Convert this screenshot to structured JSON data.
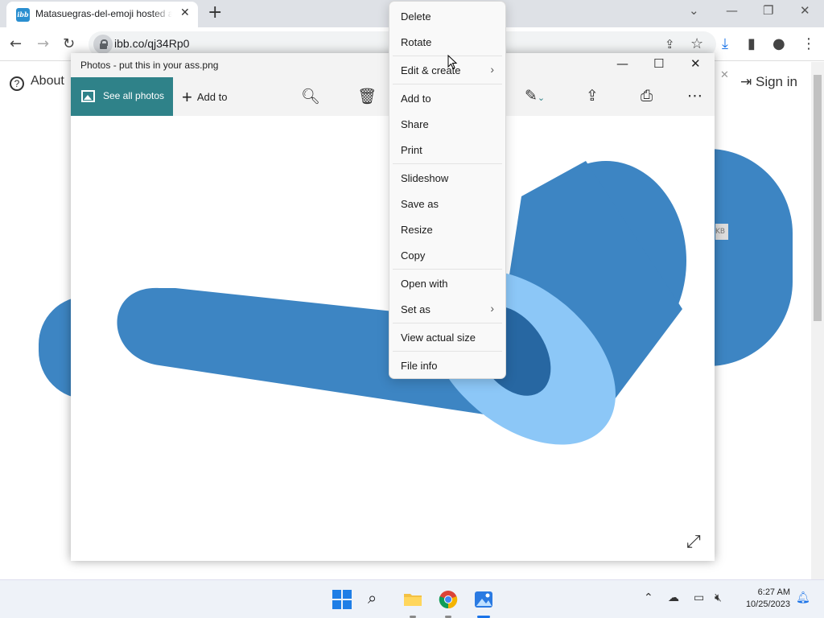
{
  "browser": {
    "tab_title": "Matasuegras-del-emoji hosted at ImgBB",
    "favicon": "ibb",
    "new_tab": "+",
    "url": "ibb.co/qj34Rp0",
    "page": {
      "about_label": "About",
      "signin_label": "Sign in",
      "side_badge": "KB"
    }
  },
  "photos_window": {
    "title": "Photos - put this in your ass.png",
    "see_all_label": "See all photos",
    "add_to_label": "Add to",
    "more_label": "⋯"
  },
  "context_menu": {
    "items": [
      {
        "label": "Delete",
        "submenu": false
      },
      {
        "label": "Rotate",
        "submenu": false
      },
      {
        "label": "Edit & create",
        "submenu": true
      },
      {
        "label": "Add to",
        "submenu": false
      },
      {
        "label": "Share",
        "submenu": false
      },
      {
        "label": "Print",
        "submenu": false
      },
      {
        "label": "Slideshow",
        "submenu": false
      },
      {
        "label": "Save as",
        "submenu": false
      },
      {
        "label": "Resize",
        "submenu": false
      },
      {
        "label": "Copy",
        "submenu": false
      },
      {
        "label": "Open with",
        "submenu": false
      },
      {
        "label": "Set as",
        "submenu": true
      },
      {
        "label": "View actual size",
        "submenu": false
      },
      {
        "label": "File info",
        "submenu": false
      }
    ]
  },
  "taskbar": {
    "time": "6:27 AM",
    "date": "10/25/2023"
  },
  "colors": {
    "photos_accent": "#2f8289",
    "shape_dark": "#3d85c3",
    "shape_light": "#8cc7f7",
    "shape_inner": "#2767a2"
  }
}
